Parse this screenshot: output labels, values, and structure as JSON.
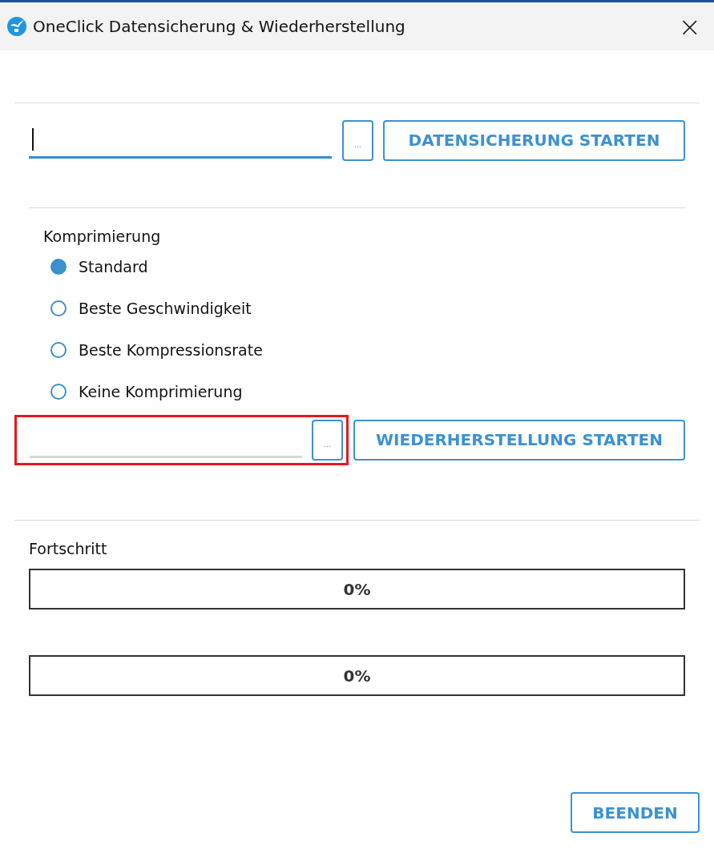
{
  "window": {
    "title": "OneClick Datensicherung & Wiederherstellung",
    "close": "×"
  },
  "backup": {
    "path": {
      "focused": true
    },
    "browse": "...",
    "start": "DATENSICHERUNG STARTEN"
  },
  "compression": {
    "label": "Komprimierung",
    "options": [
      {
        "label": "Standard",
        "selected": true
      },
      {
        "label": "Beste Geschwindigkeit",
        "selected": false
      },
      {
        "label": "Beste Kompressionsrate",
        "selected": false
      },
      {
        "label": "Keine Komprimierung",
        "selected": false
      }
    ]
  },
  "restore": {
    "path": {
      "focused": false
    },
    "browse": "...",
    "start": "WIEDERHERSTELLUNG STARTEN",
    "highlighted": true
  },
  "progress": {
    "label": "Fortschritt",
    "bars": [
      {
        "reading": "0%"
      },
      {
        "reading": "0%"
      }
    ]
  },
  "buttons": [
    "BEENDEN"
  ]
}
